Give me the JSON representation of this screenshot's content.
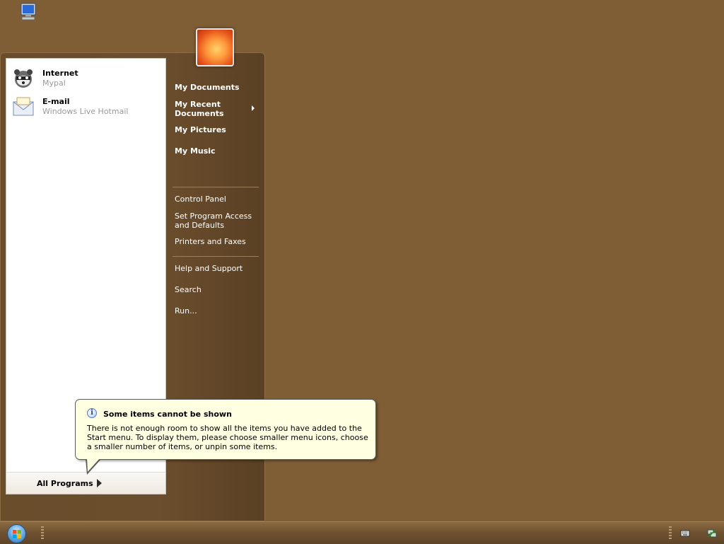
{
  "desktop": {
    "icon": "computer-icon"
  },
  "start_menu": {
    "user_picture": "user-picture-flower",
    "pinned": [
      {
        "title": "Internet",
        "subtitle": "Mypal",
        "icon": "raccoon-browser-icon"
      },
      {
        "title": "E-mail",
        "subtitle": "Windows Live Hotmail",
        "icon": "envelope-icon"
      }
    ],
    "all_programs": "All Programs",
    "places": [
      {
        "label": "My Documents"
      },
      {
        "label": "My Recent\nDocuments"
      },
      {
        "label": "My Pictures"
      },
      {
        "label": "My Music"
      }
    ],
    "system": [
      {
        "label": "Control Panel"
      },
      {
        "label": "Set Program Access\nand Defaults"
      },
      {
        "label": "Printers and Faxes"
      }
    ],
    "tools": [
      {
        "label": "Help and Support"
      },
      {
        "label": "Search"
      },
      {
        "label": "Run..."
      }
    ]
  },
  "balloon": {
    "icon": "info-icon",
    "title": "Some items cannot be shown",
    "text": "There is not enough room to show all the items you have added to the Start menu.  To display them, please choose smaller menu icons, choose a smaller number of items, or unpin some items."
  },
  "taskbar": {
    "start_button": "start-orb",
    "tray": [
      "keyboard-icon",
      "network-icon"
    ]
  },
  "colors": {
    "desktop": "#7f5e36",
    "menu_right": "#6a4d2b",
    "balloon": "#ffffe1"
  }
}
